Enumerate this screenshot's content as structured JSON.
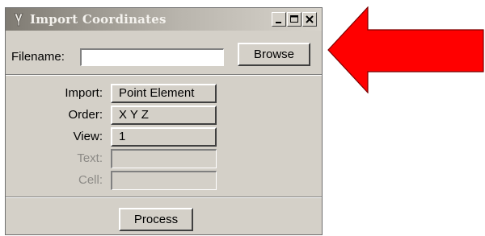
{
  "window": {
    "title": "Import Coordinates",
    "icon": "app-icon",
    "controls": [
      "minimize-icon",
      "maximize-icon",
      "close-icon"
    ]
  },
  "file": {
    "label": "Filename:",
    "value": "",
    "browse_label": "Browse"
  },
  "options": {
    "import_label": "Import:",
    "import_value": "Point Element",
    "order_label": "Order:",
    "order_value": "X Y Z",
    "view_label": "View:",
    "view_value": "1",
    "text_label": "Text:",
    "cell_label": "Cell:"
  },
  "actions": {
    "process_label": "Process"
  },
  "annotation": {
    "arrow_color": "#ff0000",
    "arrow_icon": "red-arrow-left-icon"
  }
}
